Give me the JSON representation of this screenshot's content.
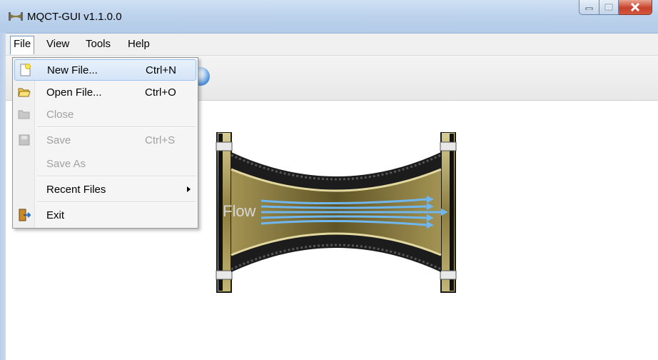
{
  "window": {
    "title": "MQCT-GUI v1.1.0.0"
  },
  "menubar": {
    "items": [
      {
        "label": "File"
      },
      {
        "label": "View"
      },
      {
        "label": "Tools"
      },
      {
        "label": "Help"
      }
    ]
  },
  "file_menu": {
    "new_file": {
      "label": "New File...",
      "shortcut": "Ctrl+N",
      "icon": "new-file-icon"
    },
    "open_file": {
      "label": "Open File...",
      "shortcut": "Ctrl+O",
      "icon": "folder-open-icon"
    },
    "close": {
      "label": "Close",
      "icon": "folder-icon",
      "disabled": true
    },
    "save": {
      "label": "Save",
      "shortcut": "Ctrl+S",
      "icon": "save-icon",
      "disabled": true
    },
    "save_as": {
      "label": "Save As",
      "disabled": true
    },
    "recent_files": {
      "label": "Recent Files",
      "icon": "submenu-arrow-icon"
    },
    "exit": {
      "label": "Exit",
      "icon": "exit-door-icon"
    }
  },
  "graphic": {
    "label": "Flow"
  },
  "colors": {
    "title_bar": "#bcd2ec",
    "close_button": "#c7422b",
    "menu_highlight": "#d4e4f7",
    "pipe_brass": "#8a7a3c",
    "flow_arrows": "#5aa8e6"
  }
}
